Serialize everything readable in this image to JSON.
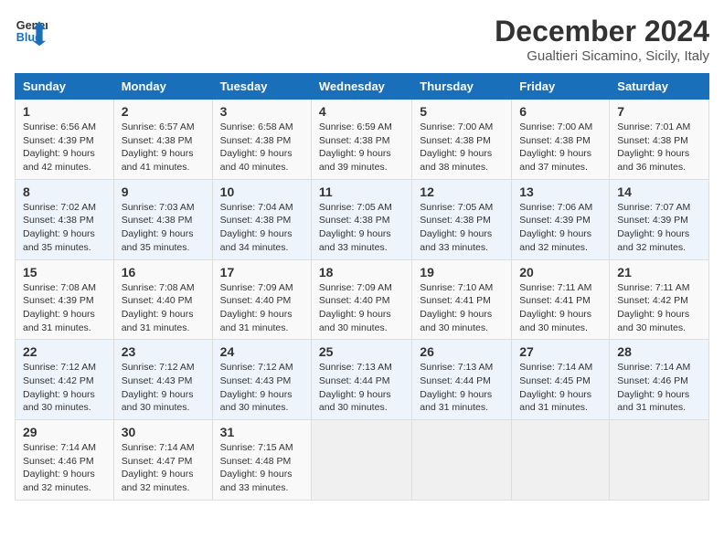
{
  "header": {
    "logo_line1": "General",
    "logo_line2": "Blue",
    "month": "December 2024",
    "location": "Gualtieri Sicamino, Sicily, Italy"
  },
  "days_of_week": [
    "Sunday",
    "Monday",
    "Tuesday",
    "Wednesday",
    "Thursday",
    "Friday",
    "Saturday"
  ],
  "weeks": [
    [
      {
        "day": 1,
        "sunrise": "6:56 AM",
        "sunset": "4:39 PM",
        "daylight": "9 hours and 42 minutes."
      },
      {
        "day": 2,
        "sunrise": "6:57 AM",
        "sunset": "4:38 PM",
        "daylight": "9 hours and 41 minutes."
      },
      {
        "day": 3,
        "sunrise": "6:58 AM",
        "sunset": "4:38 PM",
        "daylight": "9 hours and 40 minutes."
      },
      {
        "day": 4,
        "sunrise": "6:59 AM",
        "sunset": "4:38 PM",
        "daylight": "9 hours and 39 minutes."
      },
      {
        "day": 5,
        "sunrise": "7:00 AM",
        "sunset": "4:38 PM",
        "daylight": "9 hours and 38 minutes."
      },
      {
        "day": 6,
        "sunrise": "7:00 AM",
        "sunset": "4:38 PM",
        "daylight": "9 hours and 37 minutes."
      },
      {
        "day": 7,
        "sunrise": "7:01 AM",
        "sunset": "4:38 PM",
        "daylight": "9 hours and 36 minutes."
      }
    ],
    [
      {
        "day": 8,
        "sunrise": "7:02 AM",
        "sunset": "4:38 PM",
        "daylight": "9 hours and 35 minutes."
      },
      {
        "day": 9,
        "sunrise": "7:03 AM",
        "sunset": "4:38 PM",
        "daylight": "9 hours and 35 minutes."
      },
      {
        "day": 10,
        "sunrise": "7:04 AM",
        "sunset": "4:38 PM",
        "daylight": "9 hours and 34 minutes."
      },
      {
        "day": 11,
        "sunrise": "7:05 AM",
        "sunset": "4:38 PM",
        "daylight": "9 hours and 33 minutes."
      },
      {
        "day": 12,
        "sunrise": "7:05 AM",
        "sunset": "4:38 PM",
        "daylight": "9 hours and 33 minutes."
      },
      {
        "day": 13,
        "sunrise": "7:06 AM",
        "sunset": "4:39 PM",
        "daylight": "9 hours and 32 minutes."
      },
      {
        "day": 14,
        "sunrise": "7:07 AM",
        "sunset": "4:39 PM",
        "daylight": "9 hours and 32 minutes."
      }
    ],
    [
      {
        "day": 15,
        "sunrise": "7:08 AM",
        "sunset": "4:39 PM",
        "daylight": "9 hours and 31 minutes."
      },
      {
        "day": 16,
        "sunrise": "7:08 AM",
        "sunset": "4:40 PM",
        "daylight": "9 hours and 31 minutes."
      },
      {
        "day": 17,
        "sunrise": "7:09 AM",
        "sunset": "4:40 PM",
        "daylight": "9 hours and 31 minutes."
      },
      {
        "day": 18,
        "sunrise": "7:09 AM",
        "sunset": "4:40 PM",
        "daylight": "9 hours and 30 minutes."
      },
      {
        "day": 19,
        "sunrise": "7:10 AM",
        "sunset": "4:41 PM",
        "daylight": "9 hours and 30 minutes."
      },
      {
        "day": 20,
        "sunrise": "7:11 AM",
        "sunset": "4:41 PM",
        "daylight": "9 hours and 30 minutes."
      },
      {
        "day": 21,
        "sunrise": "7:11 AM",
        "sunset": "4:42 PM",
        "daylight": "9 hours and 30 minutes."
      }
    ],
    [
      {
        "day": 22,
        "sunrise": "7:12 AM",
        "sunset": "4:42 PM",
        "daylight": "9 hours and 30 minutes."
      },
      {
        "day": 23,
        "sunrise": "7:12 AM",
        "sunset": "4:43 PM",
        "daylight": "9 hours and 30 minutes."
      },
      {
        "day": 24,
        "sunrise": "7:12 AM",
        "sunset": "4:43 PM",
        "daylight": "9 hours and 30 minutes."
      },
      {
        "day": 25,
        "sunrise": "7:13 AM",
        "sunset": "4:44 PM",
        "daylight": "9 hours and 30 minutes."
      },
      {
        "day": 26,
        "sunrise": "7:13 AM",
        "sunset": "4:44 PM",
        "daylight": "9 hours and 31 minutes."
      },
      {
        "day": 27,
        "sunrise": "7:14 AM",
        "sunset": "4:45 PM",
        "daylight": "9 hours and 31 minutes."
      },
      {
        "day": 28,
        "sunrise": "7:14 AM",
        "sunset": "4:46 PM",
        "daylight": "9 hours and 31 minutes."
      }
    ],
    [
      {
        "day": 29,
        "sunrise": "7:14 AM",
        "sunset": "4:46 PM",
        "daylight": "9 hours and 32 minutes."
      },
      {
        "day": 30,
        "sunrise": "7:14 AM",
        "sunset": "4:47 PM",
        "daylight": "9 hours and 32 minutes."
      },
      {
        "day": 31,
        "sunrise": "7:15 AM",
        "sunset": "4:48 PM",
        "daylight": "9 hours and 33 minutes."
      },
      null,
      null,
      null,
      null
    ]
  ]
}
